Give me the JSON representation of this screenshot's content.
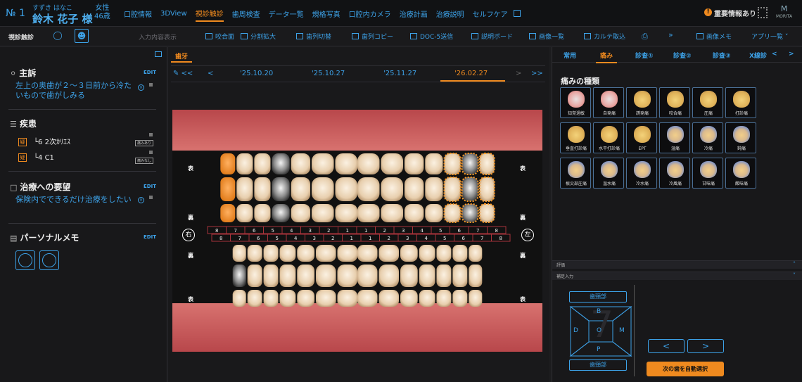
{
  "patient": {
    "no": "№ 1",
    "kana": "すずき はなこ",
    "name": "鈴木 花子 様",
    "sex": "女性",
    "age": "46歳"
  },
  "nav": {
    "tabs": [
      "口腔情報",
      "3DView",
      "視診触診",
      "歯周検査",
      "データ一覧",
      "規格写真",
      "口腔内カメラ",
      "治療計画",
      "治療説明",
      "セルフケア"
    ],
    "active": "視診触診",
    "alert": "重要情報あり",
    "brand": "MORITA"
  },
  "toolbar": {
    "label": "視診触診",
    "hint": "入力内容表示",
    "items": [
      "咬合面",
      "分割拡大",
      "歯列切替",
      "歯列コピー",
      "DOC-5送信",
      "説明ボード",
      "画像一覧",
      "カルテ取込"
    ],
    "right_items": [
      "画像メモ",
      "アプリ一覧"
    ]
  },
  "left": {
    "chief": {
      "title": "主訴",
      "edit": "EDIT",
      "text": "左上の奥歯が２～３日前から冷たいもので歯がしみる"
    },
    "disease": {
      "title": "疾患",
      "items": [
        {
          "icon": "疑",
          "tooth": "└6",
          "name": "2次ｶﾘｴｽ",
          "tag": "痛みあり"
        },
        {
          "icon": "疑",
          "tooth": "└4",
          "name": "C1",
          "tag": "痛みなし"
        }
      ]
    },
    "request": {
      "title": "治療への要望",
      "edit": "EDIT",
      "text": "保険内でできるだけ治療をしたい"
    },
    "memo": {
      "title": "パーソナルメモ",
      "edit": "EDIT"
    }
  },
  "center": {
    "tab": "歯牙",
    "dates": [
      "'25.10.20",
      "'25.10.27",
      "'25.11.27",
      "'26.02.27"
    ],
    "selected_date": "'26.02.27",
    "side_labels": {
      "front": "表",
      "back": "裏",
      "right": "右",
      "left": "左"
    },
    "upper_numbers": [
      "8",
      "7",
      "6",
      "5",
      "4",
      "3",
      "2",
      "1",
      "1",
      "2",
      "3",
      "4",
      "5",
      "6",
      "7",
      "8"
    ],
    "lower_numbers": [
      "8",
      "7",
      "6",
      "5",
      "4",
      "3",
      "2",
      "1",
      "1",
      "2",
      "3",
      "4",
      "5",
      "6",
      "7",
      "8"
    ]
  },
  "right": {
    "tabs": [
      "常用",
      "痛み",
      "診査①",
      "診査②",
      "診査③",
      "X線診"
    ],
    "active_tab": "痛み",
    "panel_title": "痛みの種類",
    "pain_types": [
      {
        "label": "知覚過敏",
        "style": "raw"
      },
      {
        "label": "自発痛",
        "style": "raw"
      },
      {
        "label": "誘発痛",
        "style": "warm"
      },
      {
        "label": "咬合痛",
        "style": "warm"
      },
      {
        "label": "圧痛",
        "style": "warm"
      },
      {
        "label": "打診痛",
        "style": "warm"
      },
      {
        "label": "垂直打診痛",
        "style": "warm"
      },
      {
        "label": "水平打診痛",
        "style": "warm"
      },
      {
        "label": "EPT",
        "style": "warm"
      },
      {
        "label": "温痛",
        "style": "cold"
      },
      {
        "label": "冷痛",
        "style": "cold"
      },
      {
        "label": "鈍痛",
        "style": "cold"
      },
      {
        "label": "根尖部圧痛",
        "style": "cold"
      },
      {
        "label": "温水痛",
        "style": "cold"
      },
      {
        "label": "冷水痛",
        "style": "cold"
      },
      {
        "label": "冷風痛",
        "style": "cold"
      },
      {
        "label": "甘味痛",
        "style": "cold"
      },
      {
        "label": "酸味痛",
        "style": "cold"
      }
    ],
    "eval_bar": "評価",
    "assist_bar": "補足入力",
    "surface": {
      "tooth": "7",
      "top": "歯頸部",
      "bottom": "歯頸部",
      "b": "B",
      "d": "D",
      "o": "O",
      "m": "M",
      "p": "P"
    },
    "prev": "<",
    "next": ">",
    "auto_select": "次の歯を自動選択"
  },
  "colors": {
    "accent": "#3da2e8",
    "active": "#ef8a1f",
    "gum": "#c9575a"
  }
}
